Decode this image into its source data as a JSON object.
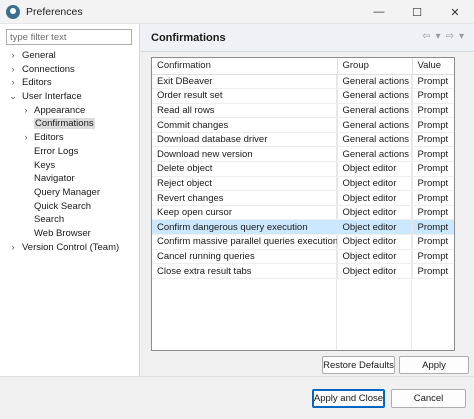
{
  "window": {
    "title": "Preferences",
    "minimize": "—",
    "maximize": "☐",
    "close": "✕"
  },
  "filter": {
    "placeholder": "type filter text",
    "value": ""
  },
  "tree": [
    {
      "label": "General",
      "level": 0,
      "chevron": "›",
      "selected": false
    },
    {
      "label": "Connections",
      "level": 0,
      "chevron": "›",
      "selected": false
    },
    {
      "label": "Editors",
      "level": 0,
      "chevron": "›",
      "selected": false
    },
    {
      "label": "User Interface",
      "level": 0,
      "chevron": "⌄",
      "selected": false
    },
    {
      "label": "Appearance",
      "level": 1,
      "chevron": "›",
      "selected": false
    },
    {
      "label": "Confirmations",
      "level": 1,
      "chevron": "",
      "selected": true
    },
    {
      "label": "Editors",
      "level": 1,
      "chevron": "›",
      "selected": false
    },
    {
      "label": "Error Logs",
      "level": 1,
      "chevron": "",
      "selected": false
    },
    {
      "label": "Keys",
      "level": 1,
      "chevron": "",
      "selected": false
    },
    {
      "label": "Navigator",
      "level": 1,
      "chevron": "",
      "selected": false
    },
    {
      "label": "Query Manager",
      "level": 1,
      "chevron": "",
      "selected": false
    },
    {
      "label": "Quick Search",
      "level": 1,
      "chevron": "",
      "selected": false
    },
    {
      "label": "Search",
      "level": 1,
      "chevron": "",
      "selected": false
    },
    {
      "label": "Web Browser",
      "level": 1,
      "chevron": "",
      "selected": false
    },
    {
      "label": "Version Control (Team)",
      "level": 0,
      "chevron": "›",
      "selected": false
    }
  ],
  "page": {
    "title": "Confirmations",
    "back_icon": "⇦",
    "back_menu_icon": "▾",
    "forward_icon": "⇨",
    "forward_menu_icon": "▾"
  },
  "table": {
    "columns": [
      "Confirmation",
      "Group",
      "Value"
    ],
    "rows": [
      [
        "Exit DBeaver",
        "General actions",
        "Prompt"
      ],
      [
        "Order result set",
        "General actions",
        "Prompt"
      ],
      [
        "Read all rows",
        "General actions",
        "Prompt"
      ],
      [
        "Commit changes",
        "General actions",
        "Prompt"
      ],
      [
        "Download database driver",
        "General actions",
        "Prompt"
      ],
      [
        "Download new version",
        "General actions",
        "Prompt"
      ],
      [
        "Delete object",
        "Object editor",
        "Prompt"
      ],
      [
        "Reject object",
        "Object editor",
        "Prompt"
      ],
      [
        "Revert changes",
        "Object editor",
        "Prompt"
      ],
      [
        "Keep open cursor",
        "Object editor",
        "Prompt"
      ],
      [
        "Confirm dangerous query execution",
        "Object editor",
        "Prompt"
      ],
      [
        "Confirm massive parallel queries execution",
        "Object editor",
        "Prompt"
      ],
      [
        "Cancel running queries",
        "Object editor",
        "Prompt"
      ],
      [
        "Close extra result tabs",
        "Object editor",
        "Prompt"
      ]
    ],
    "selected_row": 10
  },
  "buttons": {
    "restore_defaults": "Restore Defaults",
    "apply": "Apply",
    "apply_and_close": "Apply and Close",
    "cancel": "Cancel"
  },
  "colors": {
    "selection": "#cce8ff",
    "primary_border": "#0067c0",
    "header_bg": "#eef1f5"
  }
}
